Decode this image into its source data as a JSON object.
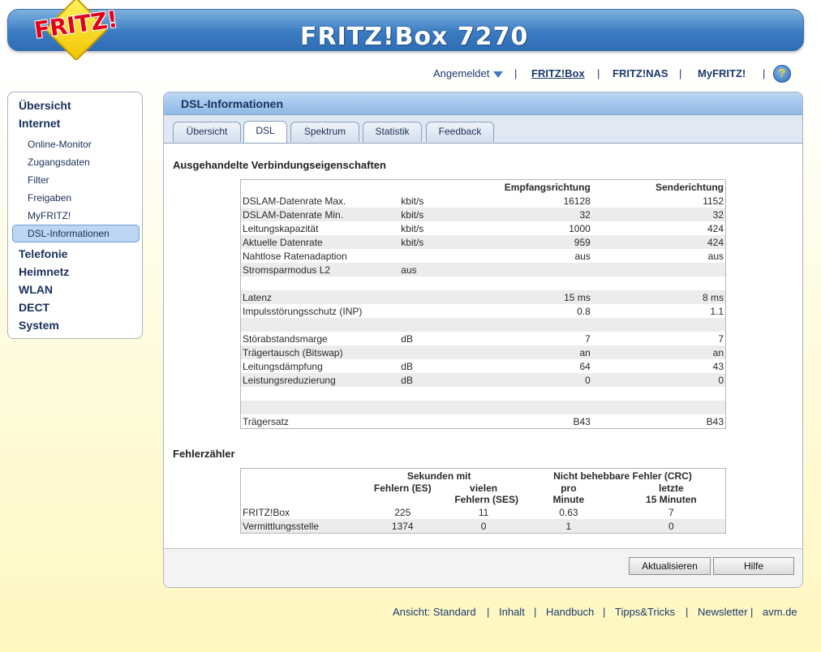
{
  "header": {
    "logo_text": "FRITZ!",
    "product": "FRITZ!Box 7270"
  },
  "topnav": {
    "login": "Angemeldet",
    "sep": "|",
    "fritzbox": "FRITZ!Box",
    "fritznas": "FRITZ!NAS",
    "myfritz": "MyFRITZ!",
    "help": "?"
  },
  "sidebar": {
    "items": [
      {
        "label": "Übersicht"
      },
      {
        "label": "Internet"
      },
      {
        "label": "Online-Monitor"
      },
      {
        "label": "Zugangsdaten"
      },
      {
        "label": "Filter"
      },
      {
        "label": "Freigaben"
      },
      {
        "label": "MyFRITZ!"
      },
      {
        "label": "DSL-Informationen"
      },
      {
        "label": "Telefonie"
      },
      {
        "label": "Heimnetz"
      },
      {
        "label": "WLAN"
      },
      {
        "label": "DECT"
      },
      {
        "label": "System"
      }
    ]
  },
  "panel": {
    "title": "DSL-Informationen",
    "tabs": [
      {
        "label": "Übersicht"
      },
      {
        "label": "DSL"
      },
      {
        "label": "Spektrum"
      },
      {
        "label": "Statistik"
      },
      {
        "label": "Feedback"
      }
    ]
  },
  "conn": {
    "section_title": "Ausgehandelte Verbindungseigenschaften",
    "headers": {
      "rx": "Empfangsrichtung",
      "tx": "Senderichtung"
    },
    "rows": [
      {
        "label": "DSLAM-Datenrate Max.",
        "unit": "kbit/s",
        "rx": "16128",
        "tx": "1152"
      },
      {
        "label": "DSLAM-Datenrate Min.",
        "unit": "kbit/s",
        "rx": "32",
        "tx": "32"
      },
      {
        "label": "Leitungskapazität",
        "unit": "kbit/s",
        "rx": "1000",
        "tx": "424"
      },
      {
        "label": "Aktuelle Datenrate",
        "unit": "kbit/s",
        "rx": "959",
        "tx": "424"
      },
      {
        "label": "Nahtlose Ratenadaption",
        "unit": "",
        "rx": "aus",
        "tx": "aus"
      },
      {
        "label": "Stromsparmodus L2",
        "unit": "aus",
        "rx": "",
        "tx": ""
      },
      {
        "label": "",
        "unit": "",
        "rx": "",
        "tx": ""
      },
      {
        "label": "Latenz",
        "unit": "",
        "rx": "15 ms",
        "tx": "8 ms"
      },
      {
        "label": "Impulsstörungsschutz (INP)",
        "unit": "",
        "rx": "0.8",
        "tx": "1.1"
      },
      {
        "label": "",
        "unit": "",
        "rx": "",
        "tx": ""
      },
      {
        "label": "Störabstandsmarge",
        "unit": "dB",
        "rx": "7",
        "tx": "7"
      },
      {
        "label": "Trägertausch (Bitswap)",
        "unit": "",
        "rx": "an",
        "tx": "an"
      },
      {
        "label": "Leitungsdämpfung",
        "unit": "dB",
        "rx": "64",
        "tx": "43"
      },
      {
        "label": "Leistungsreduzierung",
        "unit": "dB",
        "rx": "0",
        "tx": "0"
      },
      {
        "label": "",
        "unit": "",
        "rx": "",
        "tx": ""
      },
      {
        "label": "",
        "unit": "",
        "rx": "",
        "tx": ""
      },
      {
        "label": "Trägersatz",
        "unit": "",
        "rx": "B43",
        "tx": "B43"
      }
    ]
  },
  "errors": {
    "section_title": "Fehlerzähler",
    "group_seconds": "Sekunden mit",
    "group_crc": "Nicht behebbare Fehler (CRC)",
    "col_es": "Fehlern (ES)",
    "col_ses_1": "vielen",
    "col_ses_2": "Fehlern (SES)",
    "col_min_1": "pro",
    "col_min_2": "Minute",
    "col_15_1": "letzte",
    "col_15_2": "15 Minuten",
    "rows": [
      {
        "label": "FRITZ!Box",
        "es": "225",
        "ses": "11",
        "min": "0.63",
        "m15": "7"
      },
      {
        "label": "Vermittlungsstelle",
        "es": "1374",
        "ses": "0",
        "min": "1",
        "m15": "0"
      }
    ]
  },
  "buttons": {
    "refresh": "Aktualisieren",
    "help": "Hilfe"
  },
  "footer": {
    "view": "Ansicht: Standard",
    "sep": "|",
    "contents": "Inhalt",
    "manual": "Handbuch",
    "tips": "Tipps&Tricks",
    "newsletter": "Newsletter",
    "avm": "avm.de"
  }
}
